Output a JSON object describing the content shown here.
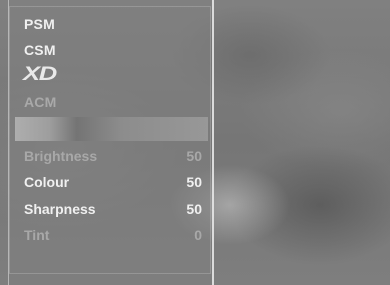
{
  "menu": {
    "modes": [
      "PSM",
      "CSM",
      "XD",
      "ACM"
    ],
    "settings": [
      {
        "label": "Brightness",
        "value": "50"
      },
      {
        "label": "Colour",
        "value": "50"
      },
      {
        "label": "Sharpness",
        "value": "50"
      },
      {
        "label": "Tint",
        "value": "0"
      }
    ]
  }
}
